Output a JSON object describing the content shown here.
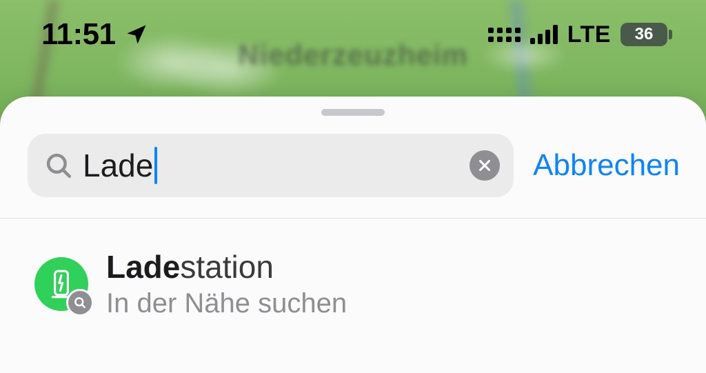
{
  "status_bar": {
    "time": "11:51",
    "location_icon": "location-arrow",
    "network_label": "LTE",
    "battery_percent": "36"
  },
  "map": {
    "blurred_place_label": "Niederzeuzheim"
  },
  "search": {
    "query": "Lade",
    "cancel_label": "Abbrechen",
    "clear_icon": "xmark",
    "search_icon": "magnifying-glass"
  },
  "suggestions": [
    {
      "icon": "ev-charger",
      "title_match": "Lade",
      "title_rest": "station",
      "subtitle": "In der Nähe suchen"
    }
  ]
}
